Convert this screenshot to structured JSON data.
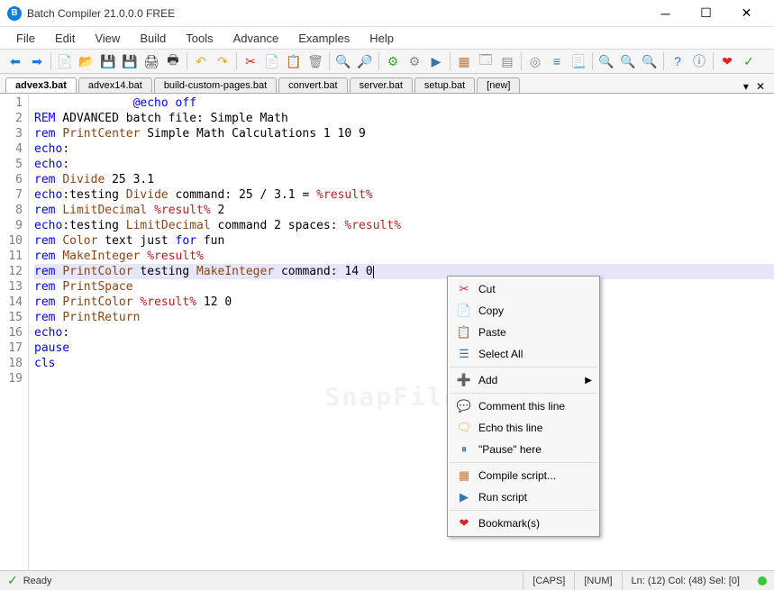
{
  "window": {
    "title": "Batch Compiler 21.0.0.0 FREE",
    "icon_letter": "B"
  },
  "menus": [
    "File",
    "Edit",
    "View",
    "Build",
    "Tools",
    "Advance",
    "Examples",
    "Help"
  ],
  "tabs": [
    {
      "label": "advex3.bat",
      "active": true
    },
    {
      "label": "advex14.bat",
      "active": false
    },
    {
      "label": "build-custom-pages.bat",
      "active": false
    },
    {
      "label": "convert.bat",
      "active": false
    },
    {
      "label": "server.bat",
      "active": false
    },
    {
      "label": "setup.bat",
      "active": false
    },
    {
      "label": "[new]",
      "active": false
    }
  ],
  "code_lines": [
    {
      "n": 1,
      "html": "              <span class='kw-cmd'>@echo off</span>"
    },
    {
      "n": 2,
      "html": "<span class='kw-rem'>REM</span> ADVANCED batch file: Simple Math"
    },
    {
      "n": 3,
      "html": "<span class='kw-rem'>rem</span> <span class='kw-func'>PrintCenter</span> Simple Math Calculations 1 10 9"
    },
    {
      "n": 4,
      "html": "<span class='kw-cmd'>echo</span>:"
    },
    {
      "n": 5,
      "html": "<span class='kw-cmd'>echo</span>:"
    },
    {
      "n": 6,
      "html": "<span class='kw-rem'>rem</span> <span class='kw-func'>Divide</span> 25 3.1"
    },
    {
      "n": 7,
      "html": "<span class='kw-cmd'>echo</span>:testing <span class='kw-func'>Divide</span> command: 25 / 3.1 = <span class='kw-var'>%result%</span>"
    },
    {
      "n": 8,
      "html": "<span class='kw-rem'>rem</span> <span class='kw-func'>LimitDecimal</span> <span class='kw-var'>%result%</span> 2"
    },
    {
      "n": 9,
      "html": "<span class='kw-cmd'>echo</span>:testing <span class='kw-func'>LimitDecimal</span> command 2 spaces: <span class='kw-var'>%result%</span>"
    },
    {
      "n": 10,
      "html": "<span class='kw-rem'>rem</span> <span class='kw-func'>Color</span> text just <span class='kw-cmd'>for</span> fun"
    },
    {
      "n": 11,
      "html": "<span class='kw-rem'>rem</span> <span class='kw-func'>MakeInteger</span> <span class='kw-var'>%result%</span>"
    },
    {
      "n": 12,
      "html": "<span class='kw-rem'>rem</span> <span class='kw-func'>PrintColor</span> testing <span class='kw-func'>MakeInteger</span> command: 14 0<span class='cursor'></span>",
      "hl": true
    },
    {
      "n": 13,
      "html": "<span class='kw-rem'>rem</span> <span class='kw-func'>PrintSpace</span>"
    },
    {
      "n": 14,
      "html": "<span class='kw-rem'>rem</span> <span class='kw-func'>PrintColor</span> <span class='kw-var'>%result%</span> 12 0"
    },
    {
      "n": 15,
      "html": "<span class='kw-rem'>rem</span> <span class='kw-func'>PrintReturn</span>"
    },
    {
      "n": 16,
      "html": "<span class='kw-cmd'>echo</span>:"
    },
    {
      "n": 17,
      "html": "<span class='kw-cmd'>pause</span>"
    },
    {
      "n": 18,
      "html": "<span class='kw-cmd'>cls</span>"
    },
    {
      "n": 19,
      "html": ""
    }
  ],
  "context_menu": [
    {
      "icon": "✂",
      "label": "Cut",
      "color": "#d22"
    },
    {
      "icon": "📄",
      "label": "Copy",
      "color": "#37a"
    },
    {
      "icon": "📋",
      "label": "Paste",
      "color": "#a76"
    },
    {
      "icon": "☰",
      "label": "Select All",
      "color": "#37a"
    },
    {
      "sep": true
    },
    {
      "icon": "➕",
      "label": "Add",
      "submenu": true,
      "color": "#3a3"
    },
    {
      "sep": true
    },
    {
      "icon": "💬",
      "label": "Comment this line",
      "color": "#da3"
    },
    {
      "icon": "🗨",
      "label": "Echo this line",
      "color": "#da3"
    },
    {
      "icon": "⏸",
      "label": "\"Pause\" here",
      "color": "#37a"
    },
    {
      "sep": true
    },
    {
      "icon": "▦",
      "label": "Compile script...",
      "color": "#c73"
    },
    {
      "icon": "▶",
      "label": "Run script",
      "color": "#37a"
    },
    {
      "sep": true
    },
    {
      "icon": "❤",
      "label": "Bookmark(s)",
      "color": "#d22"
    }
  ],
  "status": {
    "ready": "Ready",
    "caps": "[CAPS]",
    "num": "[NUM]",
    "pos": "Ln: (12) Col: (48) Sel: [0]"
  },
  "watermark": "SnapFiles",
  "toolbar_icons": [
    {
      "name": "back-icon",
      "g": "⬅",
      "c": "#0a7de0"
    },
    {
      "name": "forward-icon",
      "g": "➡",
      "c": "#0a7de0"
    },
    {
      "sep": true
    },
    {
      "name": "new-icon",
      "g": "📄",
      "c": "#3a3"
    },
    {
      "name": "open-icon",
      "g": "📂",
      "c": "#da3"
    },
    {
      "name": "save-icon",
      "g": "💾",
      "c": "#37a"
    },
    {
      "name": "save-all-icon",
      "g": "💾",
      "c": "#37a"
    },
    {
      "name": "print-icon",
      "g": "🖨",
      "c": "#333"
    },
    {
      "name": "print-preview-icon",
      "g": "🖶",
      "c": "#333"
    },
    {
      "sep": true
    },
    {
      "name": "undo-icon",
      "g": "↶",
      "c": "#da3"
    },
    {
      "name": "redo-icon",
      "g": "↷",
      "c": "#da3"
    },
    {
      "sep": true
    },
    {
      "name": "cut-icon",
      "g": "✂",
      "c": "#d22"
    },
    {
      "name": "copy-icon",
      "g": "📄",
      "c": "#37a"
    },
    {
      "name": "paste-icon",
      "g": "📋",
      "c": "#a76"
    },
    {
      "name": "delete-icon",
      "g": "🗑",
      "c": "#888"
    },
    {
      "sep": true
    },
    {
      "name": "find-icon",
      "g": "🔍",
      "c": "#333"
    },
    {
      "name": "find-replace-icon",
      "g": "🔎",
      "c": "#333"
    },
    {
      "sep": true
    },
    {
      "name": "settings-icon",
      "g": "⚙",
      "c": "#3a3"
    },
    {
      "name": "gear-icon",
      "g": "⚙",
      "c": "#888"
    },
    {
      "name": "run-icon",
      "g": "▶",
      "c": "#37a"
    },
    {
      "sep": true
    },
    {
      "name": "compile-icon",
      "g": "▦",
      "c": "#c73"
    },
    {
      "name": "window-icon",
      "g": "🗔",
      "c": "#888"
    },
    {
      "name": "table-icon",
      "g": "▤",
      "c": "#888"
    },
    {
      "sep": true
    },
    {
      "name": "target-icon",
      "g": "◎",
      "c": "#888"
    },
    {
      "name": "wrap-icon",
      "g": "≡",
      "c": "#37a"
    },
    {
      "name": "doc-icon",
      "g": "📃",
      "c": "#888"
    },
    {
      "sep": true
    },
    {
      "name": "zoom-in-icon",
      "g": "🔍",
      "c": "#3a3"
    },
    {
      "name": "zoom-out-icon",
      "g": "🔍",
      "c": "#d22"
    },
    {
      "name": "zoom-reset-icon",
      "g": "🔍",
      "c": "#888"
    },
    {
      "sep": true
    },
    {
      "name": "help-icon",
      "g": "?",
      "c": "#37a"
    },
    {
      "name": "info-icon",
      "g": "ⓘ",
      "c": "#37a"
    },
    {
      "sep": true
    },
    {
      "name": "bookmark-icon",
      "g": "❤",
      "c": "#d22"
    },
    {
      "name": "check-icon",
      "g": "✓",
      "c": "#3a3"
    }
  ]
}
